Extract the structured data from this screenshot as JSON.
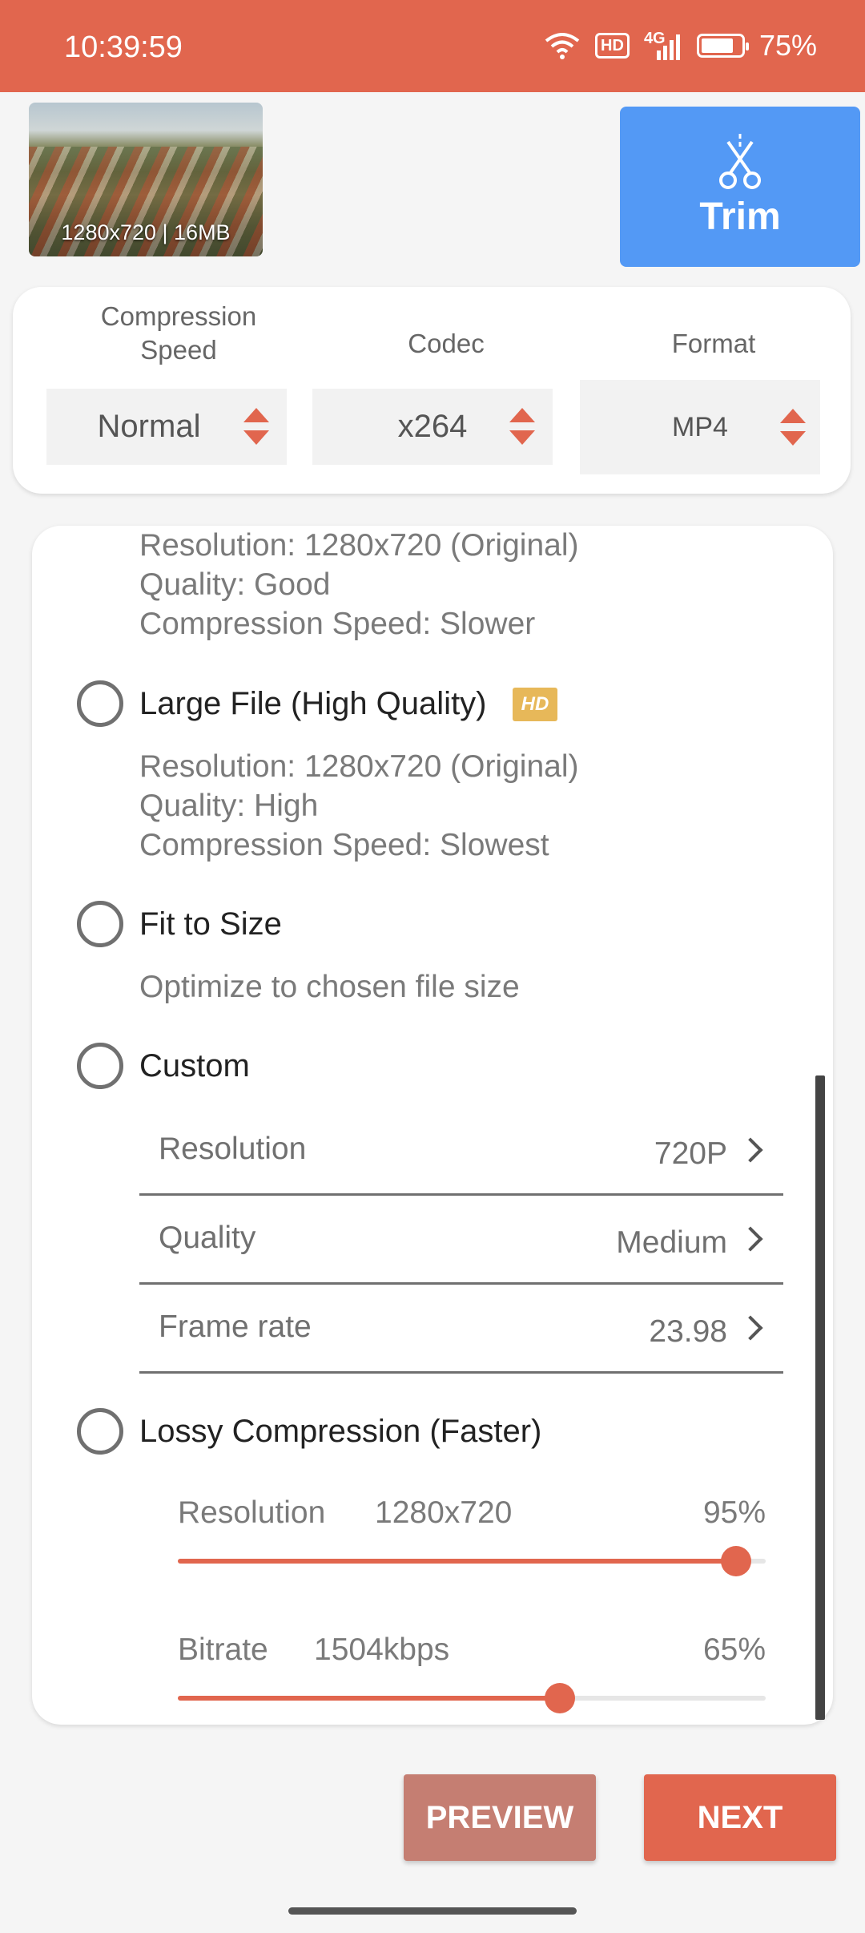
{
  "status_bar": {
    "time": "10:39:59",
    "hd": "HD",
    "network": "4G",
    "battery": "75%",
    "icons": [
      "wifi-icon",
      "hd-icon",
      "signal-icon",
      "battery-icon"
    ]
  },
  "video": {
    "thumbnail_caption": "1280x720 | 16MB"
  },
  "trim": {
    "label": "Trim",
    "icon": "scissors-icon"
  },
  "settings": {
    "compression_speed": {
      "title_line1": "Compression",
      "title_line2": "Speed",
      "value": "Normal"
    },
    "codec": {
      "title": "Codec",
      "value": "x264"
    },
    "format": {
      "title": "Format",
      "value": "MP4"
    }
  },
  "presets": {
    "partial_option": {
      "line1": "Resolution: 1280x720 (Original)",
      "line2": "Quality: Good",
      "line3": "Compression Speed: Slower"
    },
    "large_file": {
      "label": "Large File (High Quality)",
      "badge": "HD",
      "line1": "Resolution: 1280x720 (Original)",
      "line2": "Quality: High",
      "line3": "Compression Speed: Slowest",
      "selected": false
    },
    "fit_to_size": {
      "label": "Fit to Size",
      "description": "Optimize to chosen file size",
      "selected": false
    },
    "custom": {
      "label": "Custom",
      "selected": false,
      "rows": [
        {
          "name": "Resolution",
          "value": "720P"
        },
        {
          "name": "Quality",
          "value": "Medium"
        },
        {
          "name": "Frame rate",
          "value": "23.98"
        }
      ]
    },
    "lossy": {
      "label": "Lossy Compression (Faster)",
      "selected": false,
      "resolution": {
        "label": "Resolution",
        "value": "1280x720",
        "percent": "95%",
        "level": 0.95
      },
      "bitrate": {
        "label": "Bitrate",
        "value": "1504kbps",
        "percent": "65%",
        "level": 0.65
      }
    }
  },
  "actions": {
    "preview": "PREVIEW",
    "next": "NEXT"
  },
  "colors": {
    "accent": "#e1664e",
    "trim_blue": "#5399f5",
    "preview": "#c57e72",
    "hd_badge": "#e7b859"
  }
}
